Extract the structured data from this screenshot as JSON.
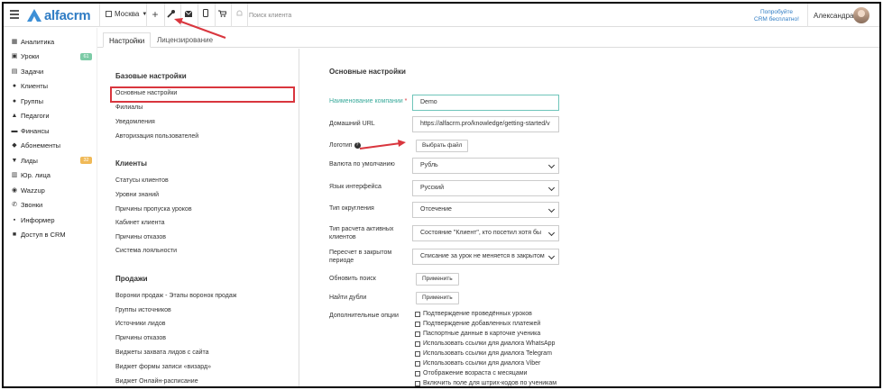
{
  "header": {
    "logo_text": "alfacrm",
    "city": "Москва",
    "search_placeholder": "Поиск клиента",
    "promo_line1": "Попробуйте",
    "promo_line2": "CRM бесплатно!",
    "user_name": "Александра",
    "icons": [
      "plus-icon",
      "wrench-icon",
      "mail-icon",
      "phone-icon",
      "cart-icon",
      "bell-icon"
    ]
  },
  "sidebar": {
    "items": [
      {
        "label": "Аналитика",
        "icon": "chart-icon"
      },
      {
        "label": "Уроки",
        "icon": "calendar-icon",
        "badge": "61"
      },
      {
        "label": "Задачи",
        "icon": "tasks-icon"
      },
      {
        "label": "Клиенты",
        "icon": "user-icon"
      },
      {
        "label": "Группы",
        "icon": "users-icon"
      },
      {
        "label": "Педагоги",
        "icon": "graduation-icon"
      },
      {
        "label": "Финансы",
        "icon": "money-icon"
      },
      {
        "label": "Абонементы",
        "icon": "tag-icon"
      },
      {
        "label": "Лиды",
        "icon": "funnel-icon",
        "badge": "32"
      },
      {
        "label": "Юр. лица",
        "icon": "building-icon"
      },
      {
        "label": "Wazzup",
        "icon": "whatsapp-icon"
      },
      {
        "label": "Звонки",
        "icon": "phone-icon"
      },
      {
        "label": "Информер",
        "icon": "informer-icon"
      },
      {
        "label": "Доступ в CRM",
        "icon": "lock-icon"
      }
    ],
    "colors": {
      "badge_green": "#7ccba6",
      "badge_orange": "#f0b957"
    }
  },
  "tabs": {
    "settings": "Настройки",
    "licensing": "Лицензирование"
  },
  "menu": {
    "base_title": "Базовые настройки",
    "base_items": [
      "Основные настройки",
      "Филиалы",
      "Уведомления",
      "Авторизация пользователей"
    ],
    "clients_title": "Клиенты",
    "clients_items": [
      "Статусы клиентов",
      "Уровни знаний",
      "Причины пропуска уроков",
      "Кабинет клиента",
      "Причины отказов",
      "Система лояльности"
    ],
    "sales_title": "Продажи",
    "sales_items": [
      "Воронки продаж - Этапы воронок продаж",
      "Группы источников",
      "Источники лидов",
      "Причины отказов",
      "Виджеты захвата лидов с сайта",
      "Виджет формы записи «визард»",
      "Виджет Онлайн-расписание"
    ]
  },
  "form": {
    "title": "Основные настройки",
    "company_label": "Наименование компании",
    "company_required": "*",
    "company_value": "Demo",
    "url_label": "Домашний URL",
    "url_value": "https://alfacrm.pro/knowledge/getting-started/v",
    "logo_label": "Логотип",
    "logo_help": "?",
    "logo_button": "Выбрать файл",
    "currency_label": "Валюта по умолчанию",
    "currency_value": "Рубль",
    "language_label": "Язык интерфейса",
    "language_value": "Русский",
    "rounding_label": "Тип округления",
    "rounding_value": "Отсечение",
    "active_label": "Тип расчета активных клиентов",
    "active_value": "Состояние \"Клиент\", кто посетил хотя бы",
    "closed_label": "Пересчет в закрытом периоде",
    "closed_value": "Списание за урок не меняется в закрытом",
    "search_label": "Обновить поиск",
    "search_button": "Применить",
    "dupes_label": "Найти дубли",
    "dupes_button": "Применить",
    "options_label": "Дополнительные опции",
    "options": [
      "Подтверждение проведённых уроков",
      "Подтверждение добавленных платежей",
      "Паспортные данные в карточке ученика",
      "Использовать ссылки для диалога WhatsApp",
      "Использовать ссылки для диалога Telegram",
      "Использовать ссылки для диалога Viber",
      "Отображение возраста с месяцами",
      "Включить поле для штрих-кодов по ученикам"
    ]
  },
  "colors": {
    "accent": "#2f7cc4",
    "highlight": "#d9363e",
    "teal": "#3aaa9b"
  }
}
